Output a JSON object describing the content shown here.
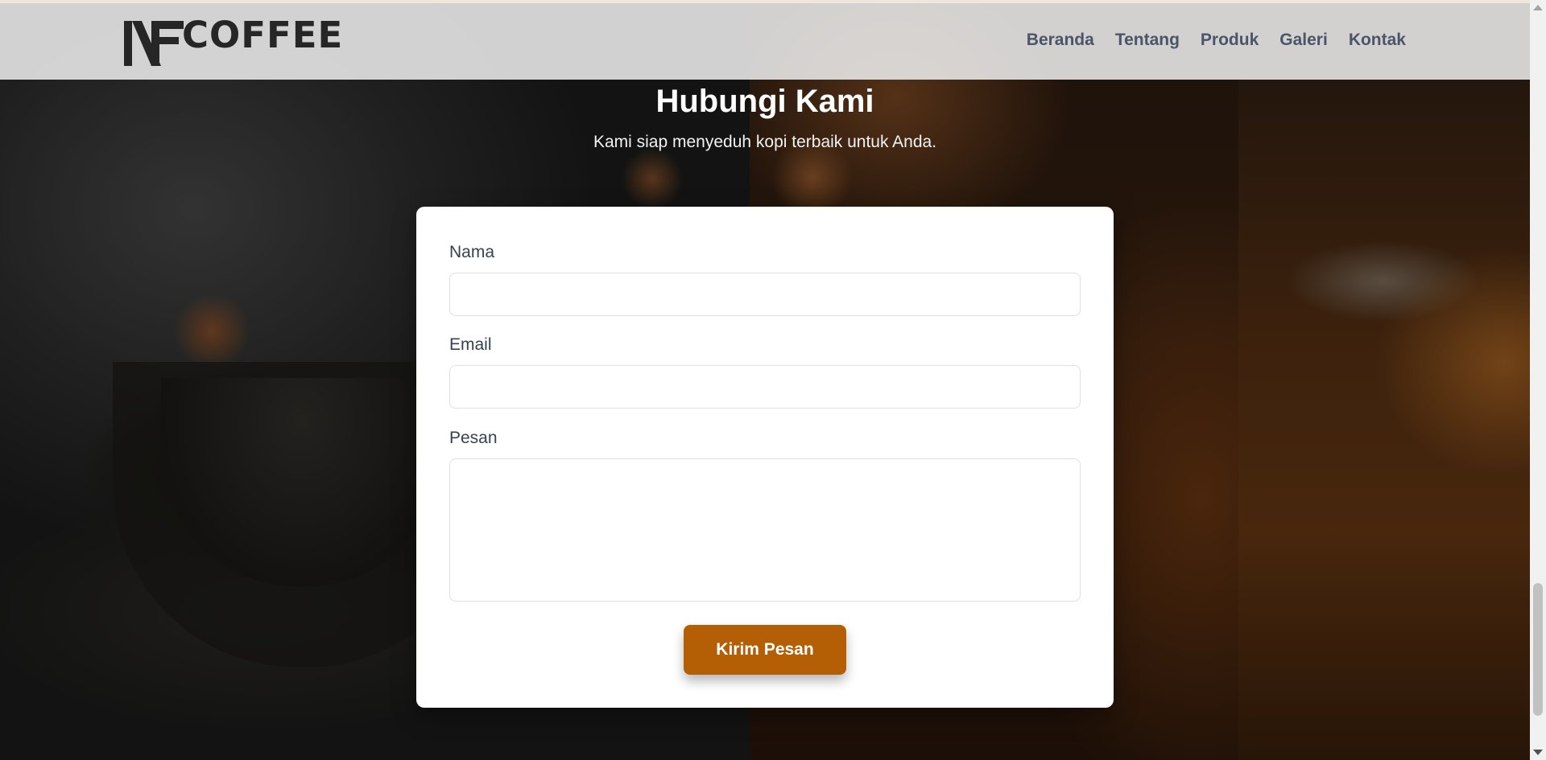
{
  "header": {
    "logo_text": "COFFEE",
    "logo_mark_text": "NF",
    "nav": [
      "Beranda",
      "Tentang",
      "Produk",
      "Galeri",
      "Kontak"
    ]
  },
  "contact": {
    "title": "Hubungi Kami",
    "subtitle": "Kami siap menyeduh kopi terbaik untuk Anda.",
    "name_label": "Nama",
    "name_value": "",
    "email_label": "Email",
    "email_value": "",
    "message_label": "Pesan",
    "message_value": "",
    "submit_label": "Kirim Pesan"
  },
  "colors": {
    "accent": "#b45f06",
    "nav_text": "#4a5568",
    "logo": "#262626"
  },
  "icons": {
    "logo_mark": "nf-monogram-icon",
    "scroll_up": "scroll-up-arrow-icon",
    "scroll_down": "scroll-down-arrow-icon"
  }
}
